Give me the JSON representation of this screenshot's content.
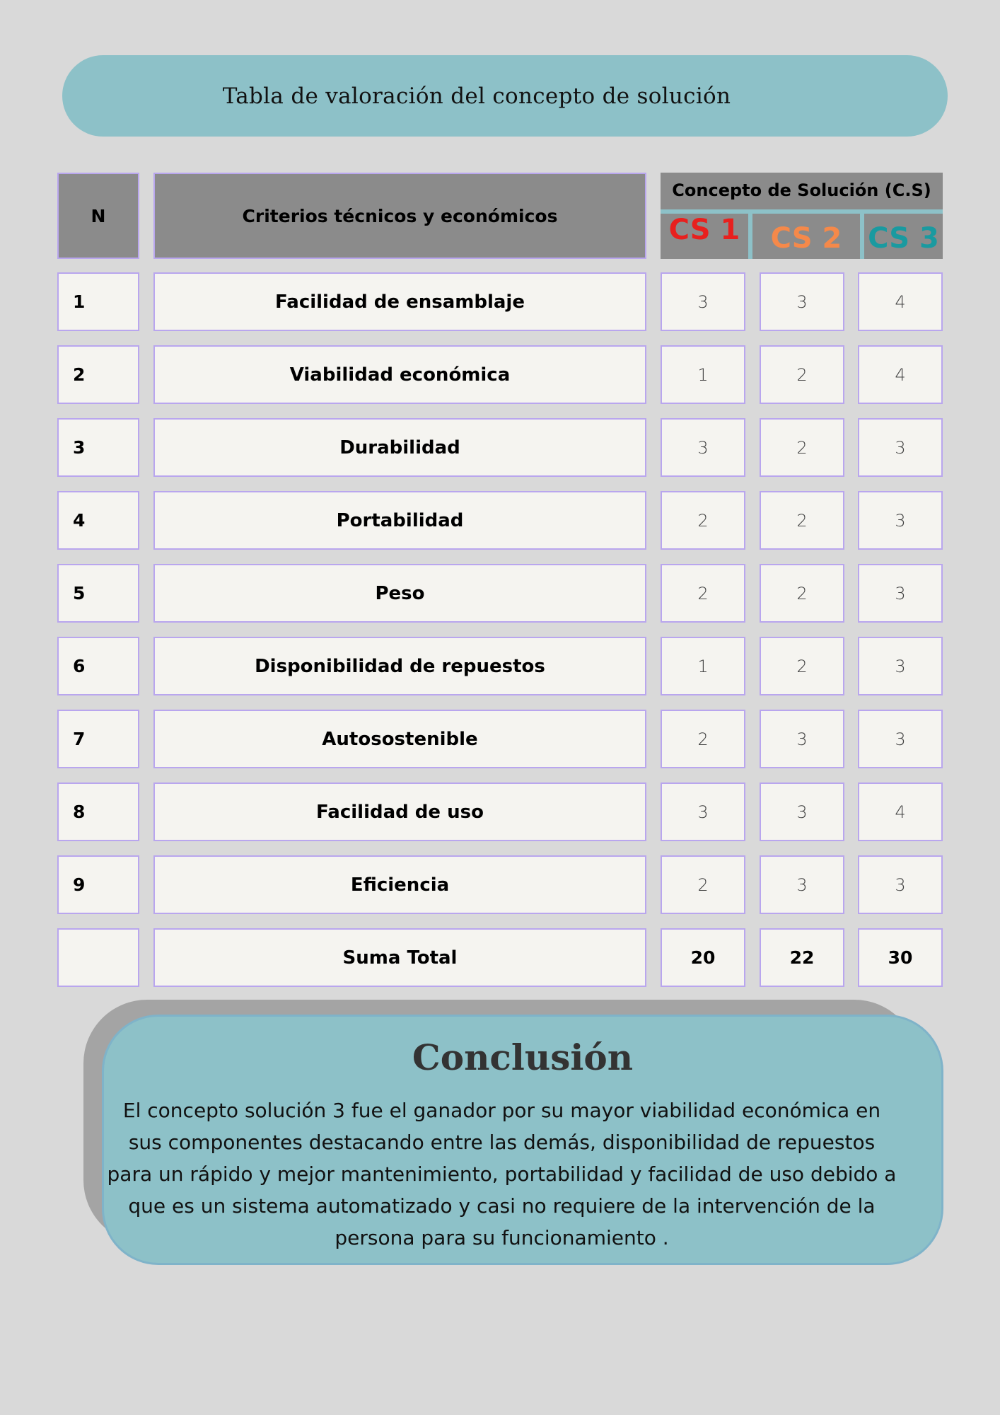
{
  "title": "Tabla de valoración del concepto de solución",
  "header": {
    "n": "N",
    "criteria": "Criterios técnicos y económicos",
    "concept_group": "Concepto de Solución (C.S)",
    "cs1": "CS 1",
    "cs2": "CS 2",
    "cs3": "CS 3"
  },
  "colors": {
    "cs1": "#e8201e",
    "cs2": "#f5894a",
    "cs3": "#1a9aa0",
    "accent": "#8dc1c8"
  },
  "rows": [
    {
      "n": "1",
      "criterion": "Facilidad de ensamblaje",
      "cs1": "3",
      "cs2": "3",
      "cs3": "4"
    },
    {
      "n": "2",
      "criterion": "Viabilidad económica",
      "cs1": "1",
      "cs2": "2",
      "cs3": "4"
    },
    {
      "n": "3",
      "criterion": "Durabilidad",
      "cs1": "3",
      "cs2": "2",
      "cs3": "3"
    },
    {
      "n": "4",
      "criterion": "Portabilidad",
      "cs1": "2",
      "cs2": "2",
      "cs3": "3"
    },
    {
      "n": "5",
      "criterion": "Peso",
      "cs1": "2",
      "cs2": "2",
      "cs3": "3"
    },
    {
      "n": "6",
      "criterion": "Disponibilidad de repuestos",
      "cs1": "1",
      "cs2": "2",
      "cs3": "3"
    },
    {
      "n": "7",
      "criterion": "Autosostenible",
      "cs1": "2",
      "cs2": "3",
      "cs3": "3"
    },
    {
      "n": "8",
      "criterion": "Facilidad de uso",
      "cs1": "3",
      "cs2": "3",
      "cs3": "4"
    },
    {
      "n": "9",
      "criterion": "Eficiencia",
      "cs1": "2",
      "cs2": "3",
      "cs3": "3"
    }
  ],
  "total": {
    "label": "Suma Total",
    "cs1": "20",
    "cs2": "22",
    "cs3": "30"
  },
  "conclusion": {
    "title": "Conclusión",
    "text": "El concepto solución 3 fue el ganador por su mayor viabilidad económica en sus componentes destacando entre las demás, disponibilidad de repuestos para un rápido y mejor mantenimiento, portabilidad y facilidad de uso debido a que es un sistema automatizado y casi no requiere de la intervención de la persona para su funcionamiento ."
  }
}
